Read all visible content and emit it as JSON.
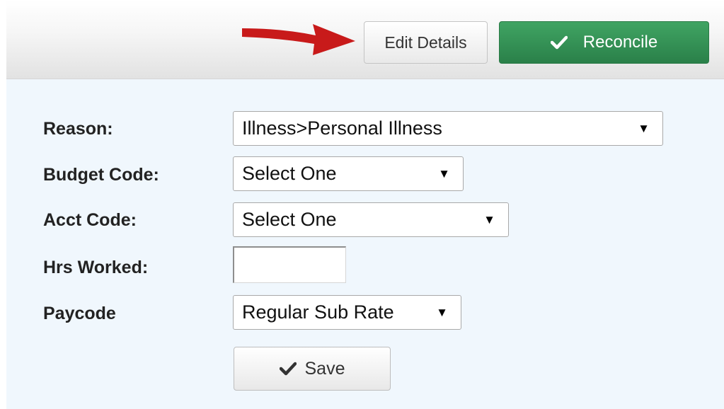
{
  "toolbar": {
    "edit_details_label": "Edit Details",
    "reconcile_label": "Reconcile"
  },
  "form": {
    "reason_label": "Reason:",
    "reason_value": "Illness>Personal Illness",
    "budget_code_label": "Budget Code:",
    "budget_code_value": "Select One",
    "acct_code_label": "Acct Code:",
    "acct_code_value": "Select One",
    "hrs_worked_label": "Hrs Worked:",
    "hrs_worked_value": "",
    "paycode_label": "Paycode",
    "paycode_value": "Regular Sub Rate",
    "save_label": "Save"
  },
  "colors": {
    "reconcile_green": "#2f8a50",
    "annotation_arrow": "#c81a1a",
    "panel_background": "#f0f7fd"
  },
  "icons": {
    "arrow": "red-arrow-annotation",
    "check": "checkmark-icon",
    "caret": "caret-down-icon"
  }
}
